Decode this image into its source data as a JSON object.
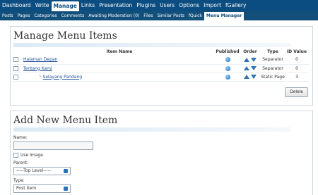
{
  "topnav": {
    "items": [
      "Dashboard",
      "Write",
      "Manage",
      "Links",
      "Presentation",
      "Plugins",
      "Users",
      "Options",
      "Import",
      "fGallery"
    ],
    "active_index": 2
  },
  "subnav": {
    "items": [
      "Posts",
      "Pages",
      "Categories",
      "Comments",
      "Awaiting Moderation (0)",
      "Files",
      "Similar Posts",
      "fQuick",
      "Menu Manager"
    ],
    "active_index": 8
  },
  "manage": {
    "title": "Manage Menu Items",
    "columns": [
      "Item Name",
      "Published",
      "Order",
      "Type",
      "ID Value"
    ],
    "rows": [
      {
        "name": "Halaman Depan",
        "type": "Separator",
        "id": "0"
      },
      {
        "name": "Tentang Kami",
        "type": "Separator",
        "id": "0"
      },
      {
        "name": "Selayang Pandang",
        "type": "Static Page",
        "id": "3",
        "child_prefix": "└"
      }
    ],
    "delete_label": "Delete"
  },
  "add": {
    "title": "Add New Menu Item",
    "name_label": "Name:",
    "use_image_label": "Use Image",
    "parent_label": "Parent:",
    "parent_value": "-----Top Level-----",
    "type_label": "Type:",
    "type_value": "Post Item"
  },
  "colors": {
    "nav": "#0b4d80",
    "subnav": "#124f7a",
    "link": "#1d4f9a",
    "accent": "#2e73b8"
  }
}
